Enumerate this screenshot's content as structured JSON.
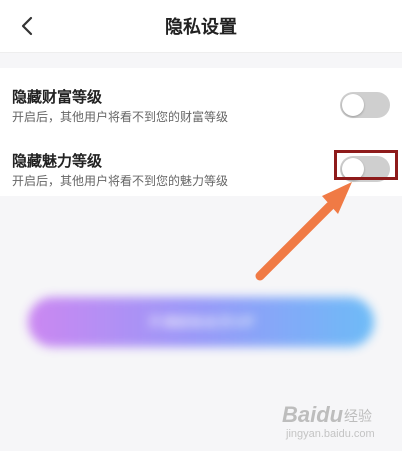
{
  "header": {
    "title": "隐私设置",
    "back_icon": "chevron-left-icon"
  },
  "settings": [
    {
      "label": "隐藏财富等级",
      "desc": "开启后，其他用户将看不到您的财富等级",
      "enabled": false
    },
    {
      "label": "隐藏魅力等级",
      "desc": "开启后，其他用户将看不到您的魅力等级",
      "enabled": false
    }
  ],
  "cta": {
    "label": "开通超级会员VIP"
  },
  "annotation": {
    "arrow_color": "#f07a45",
    "box_color": "#8e1b1b"
  },
  "watermark": {
    "brand": "Baidu",
    "cn": "经验",
    "url": "jingyan.baidu.com"
  }
}
